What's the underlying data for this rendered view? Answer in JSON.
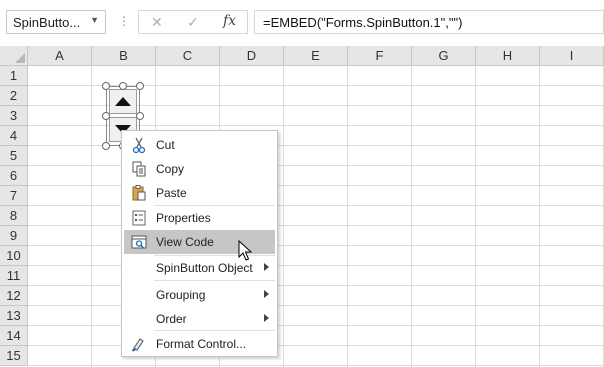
{
  "formula_bar": {
    "name_box": "SpinButto...",
    "name_box_dropdown_icon": "chevron-down-icon",
    "cancel_icon": "close-icon",
    "enter_icon": "checkmark-icon",
    "fx_label": "fx",
    "formula": "=EMBED(\"Forms.SpinButton.1\",\"\")"
  },
  "columns": [
    "A",
    "B",
    "C",
    "D",
    "E",
    "F",
    "G",
    "H",
    "I"
  ],
  "rows": [
    "1",
    "2",
    "3",
    "4",
    "5",
    "6",
    "7",
    "8",
    "9",
    "10",
    "11",
    "12",
    "13",
    "14",
    "15"
  ],
  "context_menu": {
    "items": [
      {
        "label": "Cut",
        "icon": "scissors-icon"
      },
      {
        "label": "Copy",
        "icon": "copy-icon"
      },
      {
        "label": "Paste",
        "icon": "clipboard-icon"
      },
      {
        "label": "Properties",
        "icon": "properties-icon"
      },
      {
        "label": "View Code",
        "icon": "view-code-icon",
        "highlighted": true
      },
      {
        "label": "SpinButton Object",
        "has_submenu": true
      },
      {
        "label": "Grouping",
        "has_submenu": true
      },
      {
        "label": "Order",
        "has_submenu": true
      },
      {
        "label": "Format Control...",
        "icon": "format-control-icon"
      }
    ]
  },
  "colors": {
    "header_bg": "#e6e6e6",
    "gridline": "#dcdcdc",
    "menu_highlight": "#c6c6c6"
  }
}
